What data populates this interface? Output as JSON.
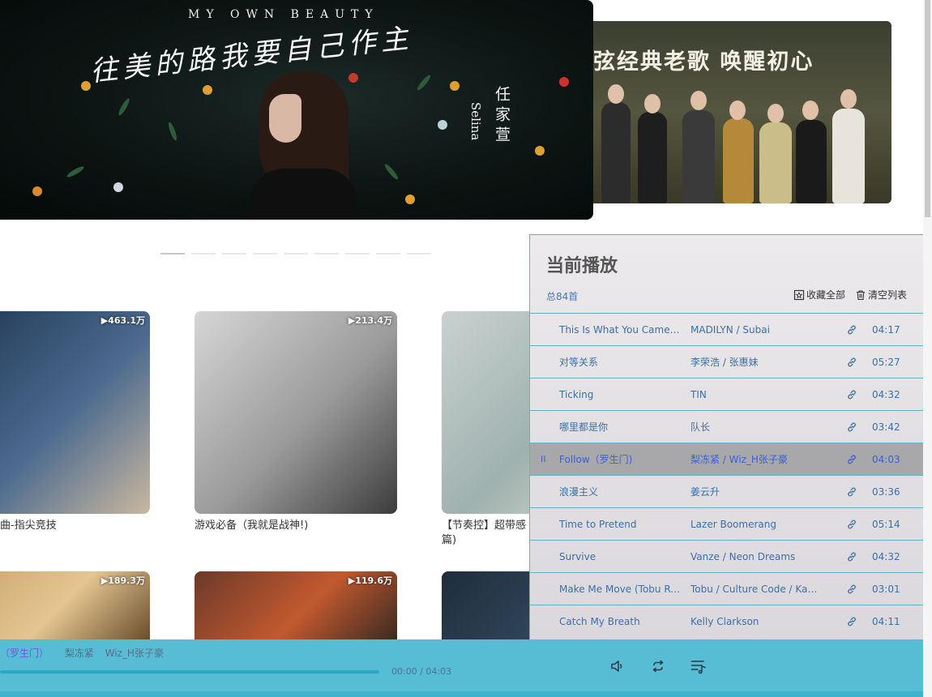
{
  "banners": {
    "main": {
      "subtitle": "MY OWN BEAUTY",
      "calligraphy": "往美的路我要自己作主",
      "artist_cn": "任家萱",
      "artist_en": "Selina"
    },
    "side": {
      "slogan": "弦经典老歌 唤醒初心"
    }
  },
  "slider": {
    "count": 9,
    "active": 0
  },
  "playlists": [
    {
      "plays": "▶463.1万",
      "title": "技」超燃神曲-指尖竞技",
      "cover": [
        "#1f3550",
        "#4b6a8f",
        "#c9b8a0"
      ]
    },
    {
      "plays": "▶213.4万",
      "title": "游戏必备（我就是战神!)",
      "cover": [
        "#d6d6d6",
        "#9a9a9a",
        "#3c3c3c"
      ]
    },
    {
      "plays": "",
      "title": "【节奏控】超带感",
      "title2": "篇)",
      "cover": [
        "#c9d2d0",
        "#9fb1ae",
        "#e2dfd6"
      ]
    },
    {
      "plays": "▶189.3万",
      "title": "",
      "cover": [
        "#c9a36a",
        "#e4c590",
        "#6b4d2e"
      ]
    },
    {
      "plays": "▶119.6万",
      "title": "",
      "cover": [
        "#6b3a2a",
        "#c2592e",
        "#3b2a22"
      ]
    },
    {
      "plays": "",
      "title": "",
      "cover": [
        "#1e2d3c",
        "#2f4458",
        "#1a2633"
      ]
    }
  ],
  "panel": {
    "title": "当前播放",
    "count": "总84首",
    "collect_all": "收藏全部",
    "clear_list": "清空列表",
    "songs": [
      {
        "name": "This Is What You Came For",
        "artist": "MADILYN / Subai",
        "duration": "04:17"
      },
      {
        "name": "对等关系",
        "artist": "李荣浩 / 张惠妹",
        "duration": "05:27"
      },
      {
        "name": "Ticking",
        "artist": "TIN",
        "duration": "04:32"
      },
      {
        "name": "哪里都是你",
        "artist": "队长",
        "duration": "03:42"
      },
      {
        "name": "Follow（罗生门)",
        "artist": "梨冻紧 / Wiz_H张子豪",
        "duration": "04:03",
        "state": "II"
      },
      {
        "name": "浪漫主义",
        "artist": "姜云升",
        "duration": "03:36"
      },
      {
        "name": "Time to Pretend",
        "artist": "Lazer Boomerang",
        "duration": "05:14"
      },
      {
        "name": "Survive",
        "artist": "Vanze / Neon Dreams",
        "duration": "04:32"
      },
      {
        "name": "Make Me Move (Tobu Re...",
        "artist": "Tobu / Culture Code / Karra",
        "duration": "03:01"
      },
      {
        "name": "Catch My Breath",
        "artist": "Kelly Clarkson",
        "duration": "04:11"
      }
    ]
  },
  "player": {
    "current_title": "（罗生门）",
    "artist1": "梨冻紧",
    "artist2": "Wiz_H张子豪",
    "time": "00:00 / 04:03",
    "progress": 0
  }
}
